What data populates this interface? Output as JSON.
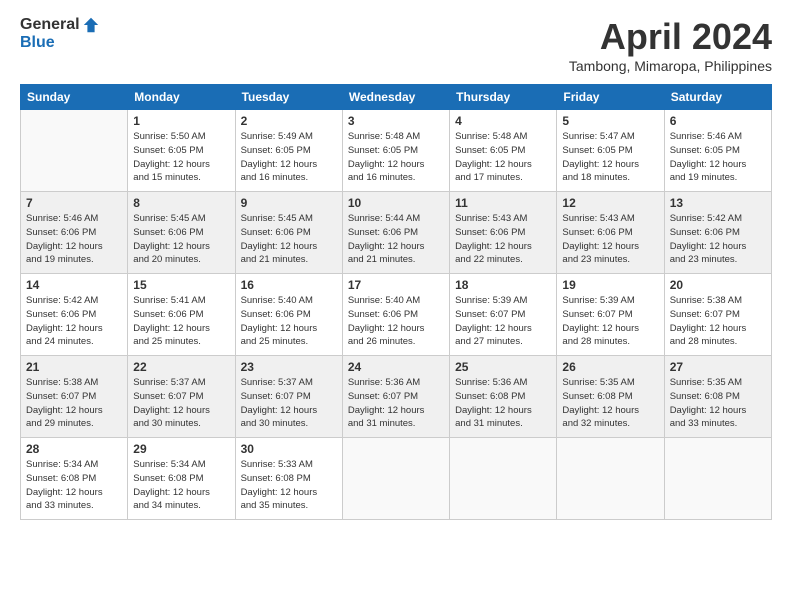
{
  "header": {
    "logo_general": "General",
    "logo_blue": "Blue",
    "month_title": "April 2024",
    "location": "Tambong, Mimaropa, Philippines"
  },
  "weekdays": [
    "Sunday",
    "Monday",
    "Tuesday",
    "Wednesday",
    "Thursday",
    "Friday",
    "Saturday"
  ],
  "weeks": [
    [
      {
        "day": "",
        "info": ""
      },
      {
        "day": "1",
        "info": "Sunrise: 5:50 AM\nSunset: 6:05 PM\nDaylight: 12 hours\nand 15 minutes."
      },
      {
        "day": "2",
        "info": "Sunrise: 5:49 AM\nSunset: 6:05 PM\nDaylight: 12 hours\nand 16 minutes."
      },
      {
        "day": "3",
        "info": "Sunrise: 5:48 AM\nSunset: 6:05 PM\nDaylight: 12 hours\nand 16 minutes."
      },
      {
        "day": "4",
        "info": "Sunrise: 5:48 AM\nSunset: 6:05 PM\nDaylight: 12 hours\nand 17 minutes."
      },
      {
        "day": "5",
        "info": "Sunrise: 5:47 AM\nSunset: 6:05 PM\nDaylight: 12 hours\nand 18 minutes."
      },
      {
        "day": "6",
        "info": "Sunrise: 5:46 AM\nSunset: 6:05 PM\nDaylight: 12 hours\nand 19 minutes."
      }
    ],
    [
      {
        "day": "7",
        "info": "Sunrise: 5:46 AM\nSunset: 6:06 PM\nDaylight: 12 hours\nand 19 minutes."
      },
      {
        "day": "8",
        "info": "Sunrise: 5:45 AM\nSunset: 6:06 PM\nDaylight: 12 hours\nand 20 minutes."
      },
      {
        "day": "9",
        "info": "Sunrise: 5:45 AM\nSunset: 6:06 PM\nDaylight: 12 hours\nand 21 minutes."
      },
      {
        "day": "10",
        "info": "Sunrise: 5:44 AM\nSunset: 6:06 PM\nDaylight: 12 hours\nand 21 minutes."
      },
      {
        "day": "11",
        "info": "Sunrise: 5:43 AM\nSunset: 6:06 PM\nDaylight: 12 hours\nand 22 minutes."
      },
      {
        "day": "12",
        "info": "Sunrise: 5:43 AM\nSunset: 6:06 PM\nDaylight: 12 hours\nand 23 minutes."
      },
      {
        "day": "13",
        "info": "Sunrise: 5:42 AM\nSunset: 6:06 PM\nDaylight: 12 hours\nand 23 minutes."
      }
    ],
    [
      {
        "day": "14",
        "info": "Sunrise: 5:42 AM\nSunset: 6:06 PM\nDaylight: 12 hours\nand 24 minutes."
      },
      {
        "day": "15",
        "info": "Sunrise: 5:41 AM\nSunset: 6:06 PM\nDaylight: 12 hours\nand 25 minutes."
      },
      {
        "day": "16",
        "info": "Sunrise: 5:40 AM\nSunset: 6:06 PM\nDaylight: 12 hours\nand 25 minutes."
      },
      {
        "day": "17",
        "info": "Sunrise: 5:40 AM\nSunset: 6:06 PM\nDaylight: 12 hours\nand 26 minutes."
      },
      {
        "day": "18",
        "info": "Sunrise: 5:39 AM\nSunset: 6:07 PM\nDaylight: 12 hours\nand 27 minutes."
      },
      {
        "day": "19",
        "info": "Sunrise: 5:39 AM\nSunset: 6:07 PM\nDaylight: 12 hours\nand 28 minutes."
      },
      {
        "day": "20",
        "info": "Sunrise: 5:38 AM\nSunset: 6:07 PM\nDaylight: 12 hours\nand 28 minutes."
      }
    ],
    [
      {
        "day": "21",
        "info": "Sunrise: 5:38 AM\nSunset: 6:07 PM\nDaylight: 12 hours\nand 29 minutes."
      },
      {
        "day": "22",
        "info": "Sunrise: 5:37 AM\nSunset: 6:07 PM\nDaylight: 12 hours\nand 30 minutes."
      },
      {
        "day": "23",
        "info": "Sunrise: 5:37 AM\nSunset: 6:07 PM\nDaylight: 12 hours\nand 30 minutes."
      },
      {
        "day": "24",
        "info": "Sunrise: 5:36 AM\nSunset: 6:07 PM\nDaylight: 12 hours\nand 31 minutes."
      },
      {
        "day": "25",
        "info": "Sunrise: 5:36 AM\nSunset: 6:08 PM\nDaylight: 12 hours\nand 31 minutes."
      },
      {
        "day": "26",
        "info": "Sunrise: 5:35 AM\nSunset: 6:08 PM\nDaylight: 12 hours\nand 32 minutes."
      },
      {
        "day": "27",
        "info": "Sunrise: 5:35 AM\nSunset: 6:08 PM\nDaylight: 12 hours\nand 33 minutes."
      }
    ],
    [
      {
        "day": "28",
        "info": "Sunrise: 5:34 AM\nSunset: 6:08 PM\nDaylight: 12 hours\nand 33 minutes."
      },
      {
        "day": "29",
        "info": "Sunrise: 5:34 AM\nSunset: 6:08 PM\nDaylight: 12 hours\nand 34 minutes."
      },
      {
        "day": "30",
        "info": "Sunrise: 5:33 AM\nSunset: 6:08 PM\nDaylight: 12 hours\nand 35 minutes."
      },
      {
        "day": "",
        "info": ""
      },
      {
        "day": "",
        "info": ""
      },
      {
        "day": "",
        "info": ""
      },
      {
        "day": "",
        "info": ""
      }
    ]
  ]
}
